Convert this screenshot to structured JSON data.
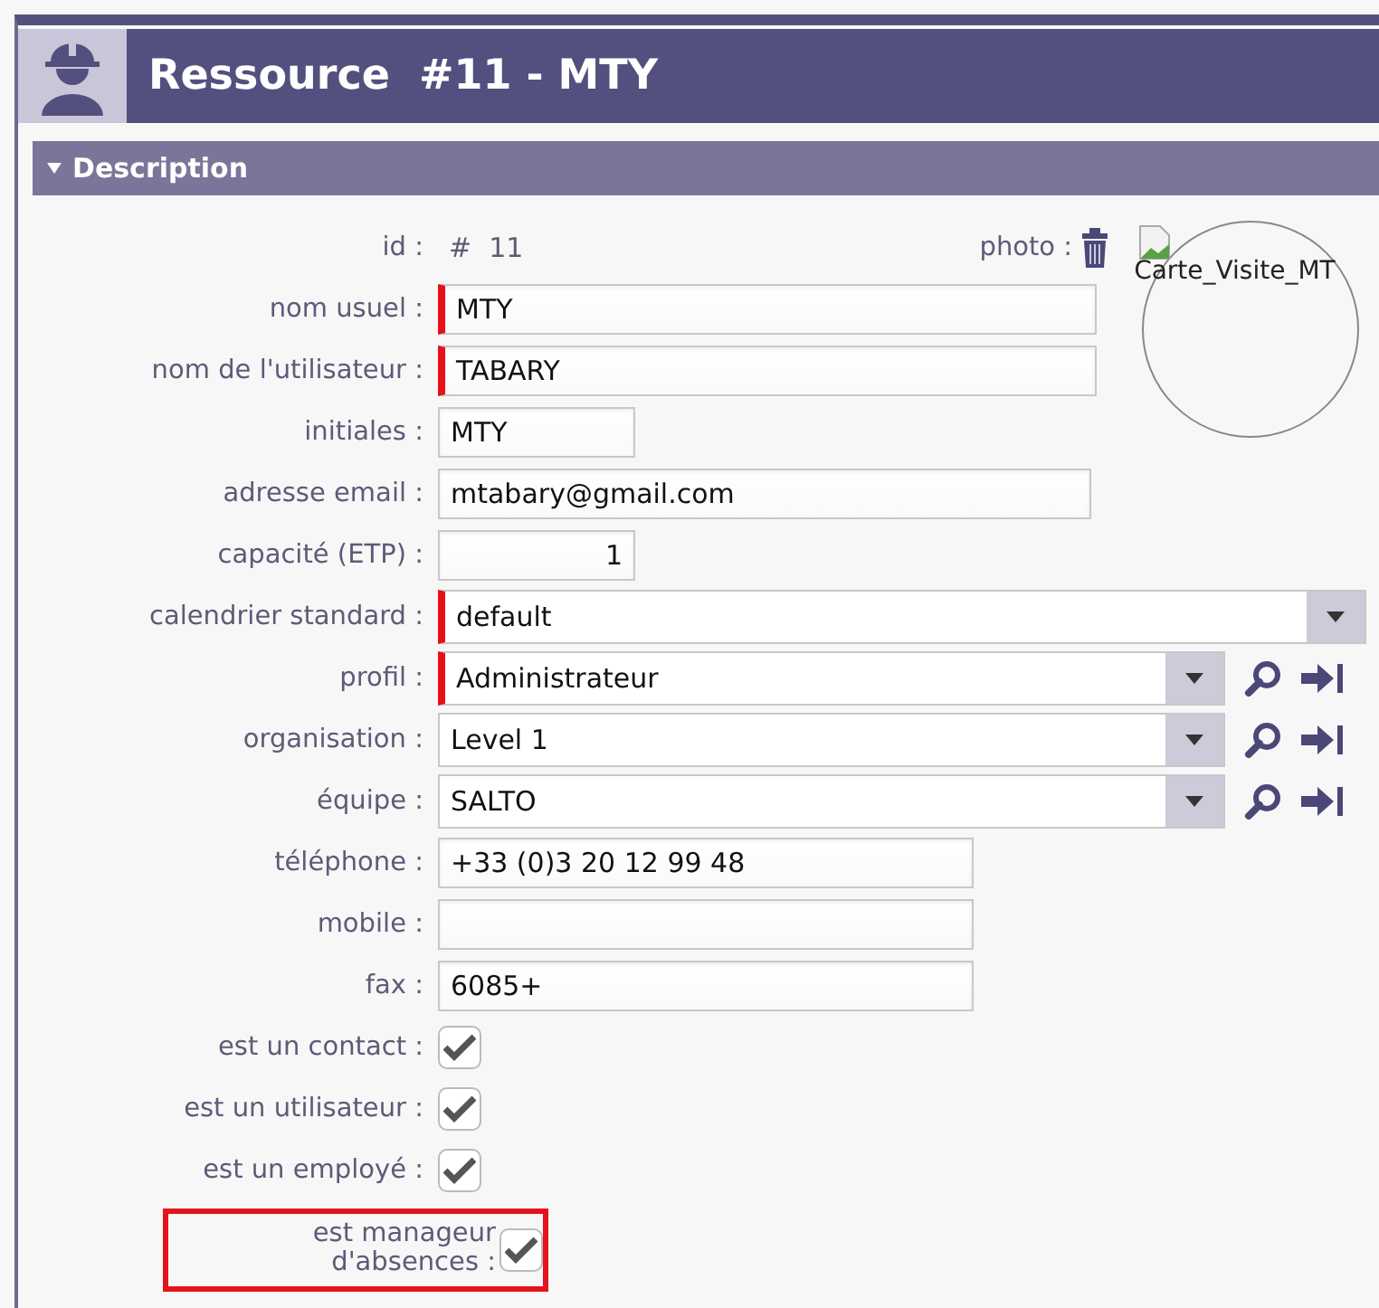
{
  "header": {
    "title": "Ressource  #11 - MTY"
  },
  "section": {
    "title": "Description",
    "expanded": true
  },
  "photo": {
    "label": "photo :",
    "alt_text": "Carte_Visite_MT"
  },
  "fields": [
    {
      "kind": "readonly",
      "label": "id :",
      "value": "#  11"
    },
    {
      "kind": "text",
      "label": "nom usuel :",
      "value": "MTY",
      "required": true
    },
    {
      "kind": "text",
      "label": "nom de l'utilisateur :",
      "value": "TABARY",
      "required": true
    },
    {
      "kind": "text",
      "label": "initiales :",
      "value": "MTY",
      "required": false
    },
    {
      "kind": "text",
      "label": "adresse email :",
      "value": "mtabary@gmail.com",
      "required": false
    },
    {
      "kind": "number",
      "label": "capacité (ETP) :",
      "value": "1",
      "required": false
    },
    {
      "kind": "select",
      "label": "calendrier standard :",
      "value": "default",
      "required": true
    },
    {
      "kind": "lookup",
      "label": "profil :",
      "value": "Administrateur",
      "required": true
    },
    {
      "kind": "lookup",
      "label": "organisation :",
      "value": "Level 1",
      "required": false
    },
    {
      "kind": "lookup",
      "label": "équipe :",
      "value": "SALTO",
      "required": false
    },
    {
      "kind": "text",
      "label": "téléphone :",
      "value": "+33 (0)3 20 12 99 48",
      "required": false
    },
    {
      "kind": "text",
      "label": "mobile :",
      "required": false
    },
    {
      "kind": "text",
      "label": "fax :",
      "value": "6085+",
      "required": false
    },
    {
      "kind": "checkbox",
      "label": "est un contact :",
      "checked": true,
      "highlighted": false
    },
    {
      "kind": "checkbox",
      "label": "est un utilisateur :",
      "checked": true,
      "highlighted": false
    },
    {
      "kind": "checkbox",
      "label": "est un employé :",
      "checked": true,
      "highlighted": false
    },
    {
      "kind": "checkbox",
      "label": "est manageur d'absences :",
      "checked": true,
      "highlighted": true
    }
  ]
}
